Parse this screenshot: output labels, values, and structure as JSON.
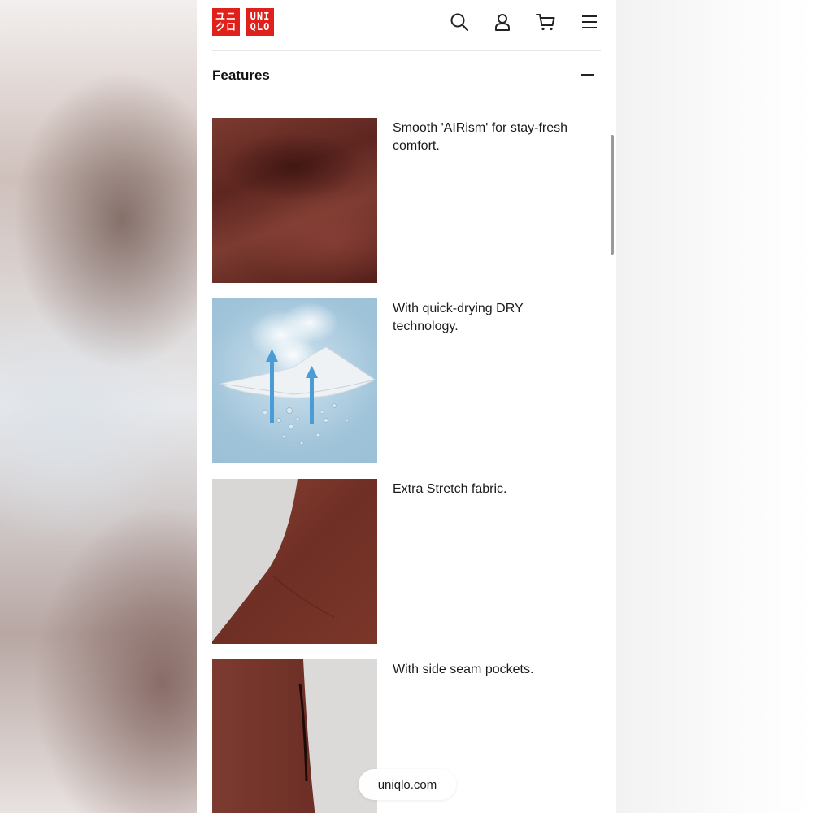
{
  "brand": {
    "logo_left": [
      "ユニ",
      "クロ"
    ],
    "logo_right": [
      "UNI",
      "QLO"
    ],
    "color": "#e0201b"
  },
  "header_icons": [
    "search-icon",
    "user-icon",
    "cart-icon",
    "menu-icon"
  ],
  "features": {
    "title": "Features",
    "expanded": true,
    "items": [
      {
        "text": "Smooth 'AIRism' for stay-fresh comfort.",
        "image": "brown-fabric-closeup"
      },
      {
        "text": "With quick-drying DRY technology.",
        "image": "dry-technology-illustration"
      },
      {
        "text": "Extra Stretch fabric.",
        "image": "stretch-fabric"
      },
      {
        "text": "With side seam pockets.",
        "image": "side-seam-pocket"
      }
    ]
  },
  "browser": {
    "url": "uniqlo.com"
  }
}
